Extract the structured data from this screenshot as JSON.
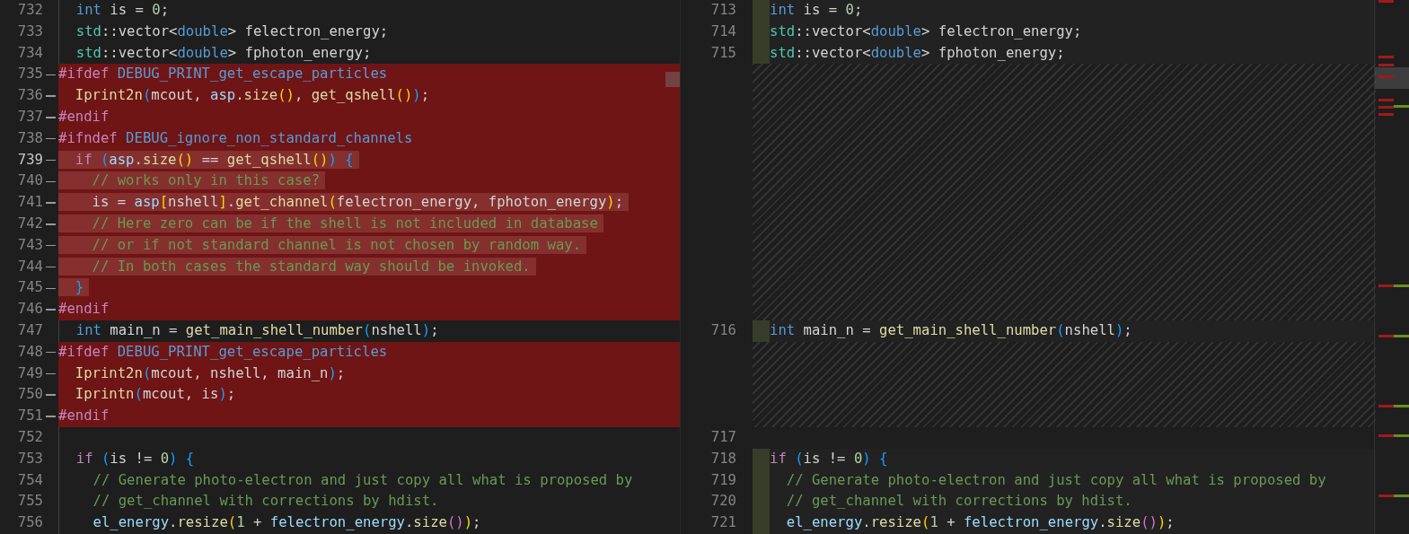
{
  "rows": [
    {
      "left": {
        "number": "732",
        "kind": "context",
        "code": [
          {
            "kind": "keyword",
            "text": "  int"
          },
          {
            "kind": "plain",
            "text": " is = "
          },
          {
            "kind": "number",
            "text": "0"
          },
          {
            "kind": "plain",
            "text": ";"
          }
        ]
      },
      "right": {
        "number": "713",
        "changed": true,
        "code": [
          {
            "kind": "keyword",
            "text": "int"
          },
          {
            "kind": "plain",
            "text": " is = "
          },
          {
            "kind": "number",
            "text": "0"
          },
          {
            "kind": "plain",
            "text": ";"
          }
        ]
      }
    },
    {
      "left": {
        "number": "733",
        "kind": "context",
        "code": [
          {
            "kind": "type",
            "text": "  std"
          },
          {
            "kind": "plain",
            "text": "::vector<"
          },
          {
            "kind": "keyword",
            "text": "double"
          },
          {
            "kind": "plain",
            "text": "> felectron_energy;"
          }
        ]
      },
      "right": {
        "number": "714",
        "changed": true,
        "code": [
          {
            "kind": "type",
            "text": "std"
          },
          {
            "kind": "plain",
            "text": "::vector<"
          },
          {
            "kind": "keyword",
            "text": "double"
          },
          {
            "kind": "plain",
            "text": "> felectron_energy;"
          }
        ]
      }
    },
    {
      "left": {
        "number": "734",
        "kind": "context",
        "code": [
          {
            "kind": "type",
            "text": "  std"
          },
          {
            "kind": "plain",
            "text": "::vector<"
          },
          {
            "kind": "keyword",
            "text": "double"
          },
          {
            "kind": "plain",
            "text": "> fphoton_energy;"
          }
        ]
      },
      "right": {
        "number": "715",
        "changed": true,
        "code": [
          {
            "kind": "type",
            "text": "std"
          },
          {
            "kind": "plain",
            "text": "::vector<"
          },
          {
            "kind": "keyword",
            "text": "double"
          },
          {
            "kind": "plain",
            "text": "> fphoton_energy;"
          }
        ]
      }
    },
    {
      "left": {
        "number": "735",
        "kind": "removed",
        "code": [
          {
            "kind": "preproc",
            "text": "#ifdef"
          },
          {
            "kind": "macro",
            "text": " DEBUG_PRINT_get_escape_particles"
          }
        ]
      }
    },
    {
      "left": {
        "number": "736",
        "kind": "removed",
        "code": [
          {
            "kind": "func",
            "text": "  Iprint2n"
          },
          {
            "kind": "bracket3",
            "text": "("
          },
          {
            "kind": "plain",
            "text": "mcout, "
          },
          {
            "kind": "var",
            "text": "asp"
          },
          {
            "kind": "plain",
            "text": "."
          },
          {
            "kind": "func",
            "text": "size"
          },
          {
            "kind": "bracket1",
            "text": "()"
          },
          {
            "kind": "plain",
            "text": ", "
          },
          {
            "kind": "func",
            "text": "get_qshell"
          },
          {
            "kind": "bracket1",
            "text": "()"
          },
          {
            "kind": "bracket3",
            "text": ")"
          },
          {
            "kind": "plain",
            "text": ";"
          }
        ]
      }
    },
    {
      "left": {
        "number": "737",
        "kind": "removed",
        "code": [
          {
            "kind": "preproc",
            "text": "#endif"
          }
        ]
      }
    },
    {
      "left": {
        "number": "738",
        "kind": "removed",
        "code": [
          {
            "kind": "preproc",
            "text": "#ifndef"
          },
          {
            "kind": "macro",
            "text": " DEBUG_ignore_non_standard_channels"
          }
        ]
      }
    },
    {
      "left": {
        "number": "739",
        "kind": "removed",
        "current": true,
        "highlighted": true,
        "code": [
          {
            "kind": "control",
            "text": "  if"
          },
          {
            "kind": "bracket3",
            "text": " ("
          },
          {
            "kind": "var",
            "text": "asp"
          },
          {
            "kind": "plain",
            "text": "."
          },
          {
            "kind": "func",
            "text": "size"
          },
          {
            "kind": "bracket1",
            "text": "()"
          },
          {
            "kind": "plain",
            "text": " == "
          },
          {
            "kind": "func",
            "text": "get_qshell"
          },
          {
            "kind": "bracket1",
            "text": "()"
          },
          {
            "kind": "bracket3",
            "text": ")"
          },
          {
            "kind": "bracket3",
            "text": " {"
          }
        ]
      }
    },
    {
      "left": {
        "number": "740",
        "kind": "removed",
        "highlighted": true,
        "code": [
          {
            "kind": "comment",
            "text": "    // works only in this case?"
          }
        ]
      }
    },
    {
      "left": {
        "number": "741",
        "kind": "removed",
        "highlighted": true,
        "code": [
          {
            "kind": "plain",
            "text": "    is = "
          },
          {
            "kind": "var",
            "text": "asp"
          },
          {
            "kind": "bracket1",
            "text": "["
          },
          {
            "kind": "plain",
            "text": "nshell"
          },
          {
            "kind": "bracket1",
            "text": "]"
          },
          {
            "kind": "plain",
            "text": "."
          },
          {
            "kind": "func",
            "text": "get_channel"
          },
          {
            "kind": "bracket1",
            "text": "("
          },
          {
            "kind": "plain",
            "text": "felectron_energy, fphoton_energy"
          },
          {
            "kind": "bracket1",
            "text": ")"
          },
          {
            "kind": "plain",
            "text": ";"
          }
        ]
      }
    },
    {
      "left": {
        "number": "742",
        "kind": "removed",
        "highlighted": true,
        "code": [
          {
            "kind": "comment",
            "text": "    // Here zero can be if the shell is not included in database"
          }
        ]
      }
    },
    {
      "left": {
        "number": "743",
        "kind": "removed",
        "highlighted": true,
        "code": [
          {
            "kind": "comment",
            "text": "    // or if not standard channel is not chosen by random way."
          }
        ]
      }
    },
    {
      "left": {
        "number": "744",
        "kind": "removed",
        "highlighted": true,
        "code": [
          {
            "kind": "comment",
            "text": "    // In both cases the standard way should be invoked."
          }
        ]
      }
    },
    {
      "left": {
        "number": "745",
        "kind": "removed",
        "highlighted": true,
        "code": [
          {
            "kind": "bracket3",
            "text": "  }"
          }
        ]
      }
    },
    {
      "left": {
        "number": "746",
        "kind": "removed",
        "code": [
          {
            "kind": "preproc",
            "text": "#endif"
          }
        ]
      }
    },
    {
      "left": {
        "number": "747",
        "kind": "context",
        "code": [
          {
            "kind": "keyword",
            "text": "  int"
          },
          {
            "kind": "plain",
            "text": " main_n = "
          },
          {
            "kind": "func",
            "text": "get_main_shell_number"
          },
          {
            "kind": "bracket3",
            "text": "("
          },
          {
            "kind": "plain",
            "text": "nshell"
          },
          {
            "kind": "bracket3",
            "text": ")"
          },
          {
            "kind": "plain",
            "text": ";"
          }
        ]
      },
      "right": {
        "number": "716",
        "changed": true,
        "code": [
          {
            "kind": "keyword",
            "text": "int"
          },
          {
            "kind": "plain",
            "text": " main_n = "
          },
          {
            "kind": "func",
            "text": "get_main_shell_number"
          },
          {
            "kind": "bracket3",
            "text": "("
          },
          {
            "kind": "plain",
            "text": "nshell"
          },
          {
            "kind": "bracket3",
            "text": ")"
          },
          {
            "kind": "plain",
            "text": ";"
          }
        ]
      }
    },
    {
      "left": {
        "number": "748",
        "kind": "removed",
        "code": [
          {
            "kind": "preproc",
            "text": "#ifdef"
          },
          {
            "kind": "macro",
            "text": " DEBUG_PRINT_get_escape_particles"
          }
        ]
      }
    },
    {
      "left": {
        "number": "749",
        "kind": "removed",
        "code": [
          {
            "kind": "func",
            "text": "  Iprint2n"
          },
          {
            "kind": "bracket3",
            "text": "("
          },
          {
            "kind": "plain",
            "text": "mcout, nshell, main_n"
          },
          {
            "kind": "bracket3",
            "text": ")"
          },
          {
            "kind": "plain",
            "text": ";"
          }
        ]
      }
    },
    {
      "left": {
        "number": "750",
        "kind": "removed",
        "code": [
          {
            "kind": "func",
            "text": "  Iprintn"
          },
          {
            "kind": "bracket3",
            "text": "("
          },
          {
            "kind": "plain",
            "text": "mcout, is"
          },
          {
            "kind": "bracket3",
            "text": ")"
          },
          {
            "kind": "plain",
            "text": ";"
          }
        ]
      }
    },
    {
      "left": {
        "number": "751",
        "kind": "removed",
        "code": [
          {
            "kind": "preproc",
            "text": "#endif"
          }
        ]
      }
    },
    {
      "left": {
        "number": "752",
        "kind": "context"
      },
      "right": {
        "number": "717",
        "changed": false
      }
    },
    {
      "left": {
        "number": "753",
        "kind": "context",
        "code": [
          {
            "kind": "control",
            "text": "  if"
          },
          {
            "kind": "bracket3",
            "text": " ("
          },
          {
            "kind": "plain",
            "text": "is != "
          },
          {
            "kind": "number",
            "text": "0"
          },
          {
            "kind": "bracket3",
            "text": ")"
          },
          {
            "kind": "bracket3",
            "text": " {"
          }
        ]
      },
      "right": {
        "number": "718",
        "changed": true,
        "code": [
          {
            "kind": "control",
            "text": "if"
          },
          {
            "kind": "bracket3",
            "text": " ("
          },
          {
            "kind": "plain",
            "text": "is != "
          },
          {
            "kind": "number",
            "text": "0"
          },
          {
            "kind": "bracket3",
            "text": ")"
          },
          {
            "kind": "bracket3",
            "text": " {"
          }
        ]
      }
    },
    {
      "left": {
        "number": "754",
        "kind": "context",
        "code": [
          {
            "kind": "comment",
            "text": "    // Generate photo-electron and just copy all what is proposed by"
          }
        ]
      },
      "right": {
        "number": "719",
        "changed": true,
        "code": [
          {
            "kind": "comment",
            "text": "  // Generate photo-electron and just copy all what is proposed by"
          }
        ]
      }
    },
    {
      "left": {
        "number": "755",
        "kind": "context",
        "code": [
          {
            "kind": "comment",
            "text": "    // get_channel with corrections by hdist."
          }
        ]
      },
      "right": {
        "number": "720",
        "changed": true,
        "code": [
          {
            "kind": "comment",
            "text": "  // get_channel with corrections by hdist."
          }
        ]
      }
    },
    {
      "left": {
        "number": "756",
        "kind": "context",
        "code": [
          {
            "kind": "var",
            "text": "    el_energy"
          },
          {
            "kind": "plain",
            "text": "."
          },
          {
            "kind": "func",
            "text": "resize"
          },
          {
            "kind": "bracket1",
            "text": "("
          },
          {
            "kind": "number",
            "text": "1"
          },
          {
            "kind": "plain",
            "text": " + "
          },
          {
            "kind": "var",
            "text": "felectron_energy"
          },
          {
            "kind": "plain",
            "text": "."
          },
          {
            "kind": "func",
            "text": "size"
          },
          {
            "kind": "bracket2",
            "text": "()"
          },
          {
            "kind": "bracket1",
            "text": ")"
          },
          {
            "kind": "plain",
            "text": ";"
          }
        ]
      },
      "right": {
        "number": "721",
        "changed": true,
        "code": [
          {
            "kind": "var",
            "text": "  el_energy"
          },
          {
            "kind": "plain",
            "text": "."
          },
          {
            "kind": "func",
            "text": "resize"
          },
          {
            "kind": "bracket1",
            "text": "("
          },
          {
            "kind": "number",
            "text": "1"
          },
          {
            "kind": "plain",
            "text": " + "
          },
          {
            "kind": "var",
            "text": "felectron_energy"
          },
          {
            "kind": "plain",
            "text": "."
          },
          {
            "kind": "func",
            "text": "size"
          },
          {
            "kind": "bracket2",
            "text": "()"
          },
          {
            "kind": "bracket1",
            "text": ")"
          },
          {
            "kind": "plain",
            "text": ";"
          }
        ]
      }
    }
  ]
}
